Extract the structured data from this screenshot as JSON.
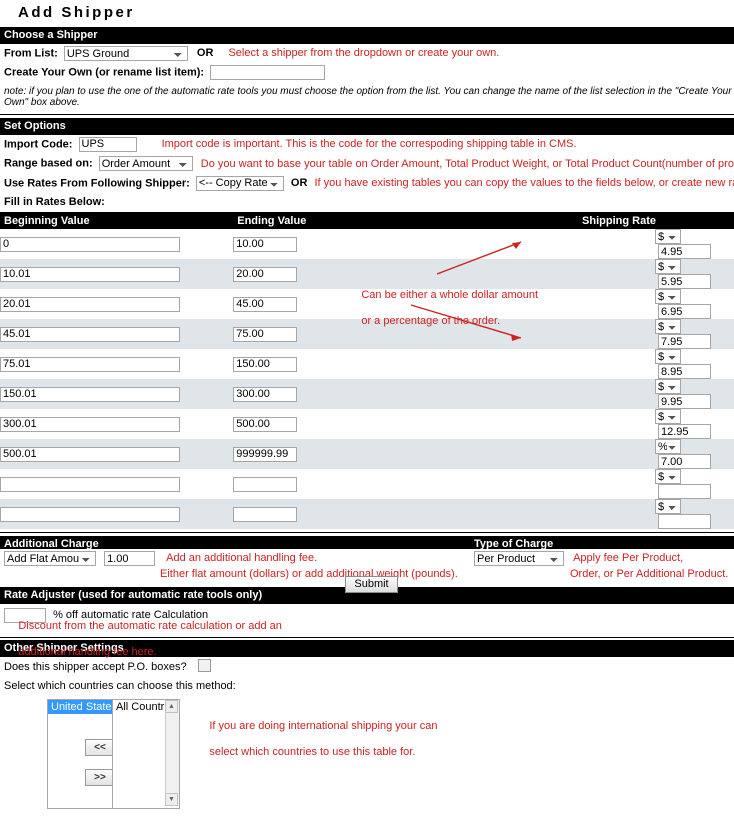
{
  "page": {
    "title": "Add  Shipper"
  },
  "choose_shipper": {
    "section_title": "Choose a Shipper",
    "from_list_label": "From List:",
    "from_list_value": "UPS Ground",
    "or_label": "OR",
    "from_list_note": "Select a shipper from the dropdown or create your own.",
    "create_own_label": "Create Your Own (or rename list item):",
    "create_own_value": "",
    "create_own_placeholder": "",
    "footnote": "note: if you plan to use the one of the automatic rate tools you must choose the option from the list. You can change the name of the list selection in the \"Create Your Own\" box above."
  },
  "set_options": {
    "section_title": "Set Options",
    "import_code_label": "Import Code:",
    "import_code_value": "UPS",
    "import_code_note": "Import code is important. This is the code for the correspoding shipping table in CMS.",
    "range_label": "Range based on:",
    "range_value": "Order Amount",
    "range_note": "Do you want to base your table on Order Amount, Total Product Weight, or Total Product Count(number of products)?",
    "copy_rates_label": "Use Rates From Following Shipper:",
    "copy_rates_value": "<-- Copy Rates -->",
    "copy_rates_or": "OR",
    "copy_rates_note": "If you have existing tables you can copy the values to the fields below, or create new rates.",
    "fill_in_label": "Fill in Rates Below:"
  },
  "rates_table": {
    "headers": [
      "Beginning Value",
      "Ending Value",
      "Shipping Rate"
    ],
    "rows": [
      {
        "begin": "0",
        "end": "10.00",
        "symbol": "$",
        "rate": "4.95"
      },
      {
        "begin": "10.01",
        "end": "20.00",
        "symbol": "$",
        "rate": "5.95"
      },
      {
        "begin": "20.01",
        "end": "45.00",
        "symbol": "$",
        "rate": "6.95"
      },
      {
        "begin": "45.01",
        "end": "75.00",
        "symbol": "$",
        "rate": "7.95"
      },
      {
        "begin": "75.01",
        "end": "150.00",
        "symbol": "$",
        "rate": "8.95"
      },
      {
        "begin": "150.01",
        "end": "300.00",
        "symbol": "$",
        "rate": "9.95"
      },
      {
        "begin": "300.01",
        "end": "500.00",
        "symbol": "$",
        "rate": "12.95"
      },
      {
        "begin": "500.01",
        "end": "999999.99",
        "symbol": "%",
        "rate": "7.00"
      },
      {
        "begin": "",
        "end": "",
        "symbol": "$",
        "rate": ""
      },
      {
        "begin": "",
        "end": "",
        "symbol": "$",
        "rate": ""
      }
    ],
    "symbol_options": [
      "$",
      "%"
    ],
    "annotation_line1": "Can be either a whole dollar amount",
    "annotation_line2": "or a percentage of the order."
  },
  "additional_charge": {
    "section_title": "Additional Charge",
    "type_value": "Add Flat Amount ($)",
    "amount_value": "1.00",
    "note_line1": "Add an additional handling fee.",
    "note_line2": "Either flat amount (dollars) or add additional weight (pounds)."
  },
  "type_of_charge": {
    "section_title": "Type of Charge",
    "value": "Per Product",
    "note_line1": "Apply fee Per Product,",
    "note_line2": "Order, or Per Additional Product."
  },
  "rate_adjuster": {
    "section_title": "Rate Adjuster (used for automatic rate tools only)",
    "field_value": "",
    "label_prefix": "% off automatic rate Calculation",
    "note_line1": "Discount from the automatic rate calculation or add an",
    "note_line2": "additional handling fee here."
  },
  "other_settings": {
    "section_title": "Other Shipper Settings",
    "po_box_label": "Does this shipper accept P.O. boxes?",
    "po_box_checked": false,
    "countries_label": "Select which countries can choose this method:",
    "selected_countries": [
      "United States"
    ],
    "available_countries": [
      "All Countries"
    ],
    "move_left_label": "<<",
    "move_right_label": ">>",
    "countries_note_line1": "If you are doing international shipping your can",
    "countries_note_line2": "select which countries to use this table for."
  },
  "submit": {
    "label": "Submit"
  },
  "colors": {
    "annotation": "#cc2222",
    "bar_bg": "#000000",
    "row_alt": "#dfe5e8",
    "highlight": "#3399ff"
  }
}
